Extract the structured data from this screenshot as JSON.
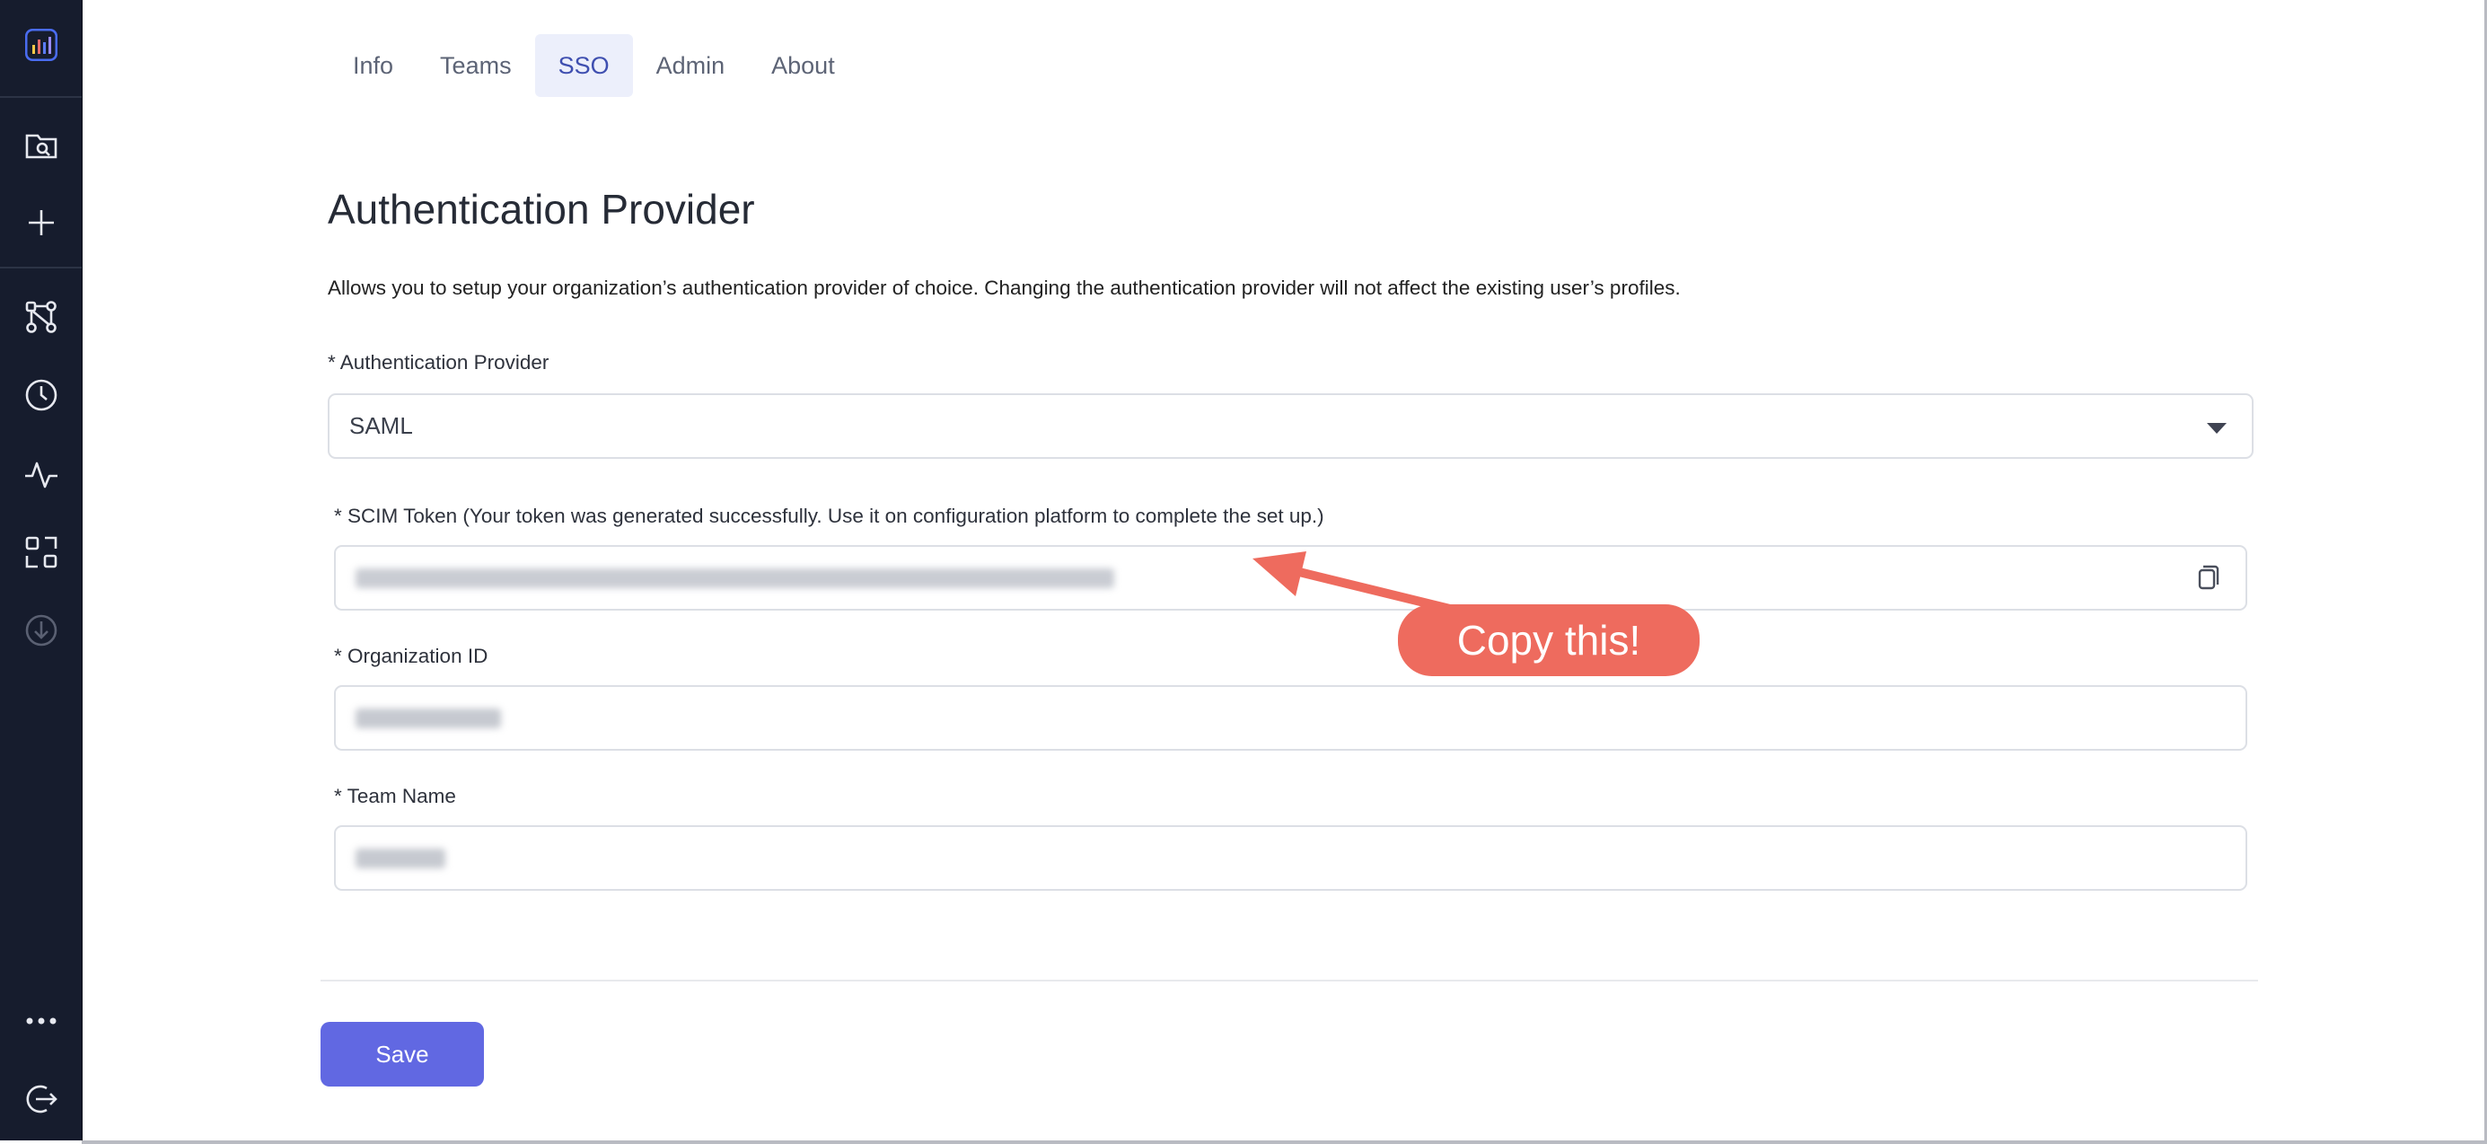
{
  "sidebar": {
    "icons": [
      "analytics-logo-icon",
      "folder-search-icon",
      "plus-icon",
      "workflow-icon",
      "clock-icon",
      "activity-icon",
      "scan-icon",
      "download-icon",
      "more-icon",
      "logout-icon"
    ]
  },
  "tabs": [
    {
      "label": "Info",
      "active": false
    },
    {
      "label": "Teams",
      "active": false
    },
    {
      "label": "SSO",
      "active": true
    },
    {
      "label": "Admin",
      "active": false
    },
    {
      "label": "About",
      "active": false
    }
  ],
  "page": {
    "title": "Authentication Provider",
    "description": "Allows you to setup your organization’s authentication provider of choice. Changing the authentication provider will not affect the existing user’s profiles."
  },
  "form": {
    "provider_label": "* Authentication Provider",
    "provider_value": "SAML",
    "scim_label": "* SCIM Token (Your token was generated successfully. Use it on configuration platform to complete the set up.)",
    "org_label": "* Organization ID",
    "team_label": "* Team Name",
    "save_label": "Save"
  },
  "annotation": {
    "text": "Copy this!",
    "color": "#ee6b5e"
  },
  "colors": {
    "sidebar": "#161c2d",
    "accent": "#6168e2",
    "active_tab_bg": "#eceffb"
  }
}
